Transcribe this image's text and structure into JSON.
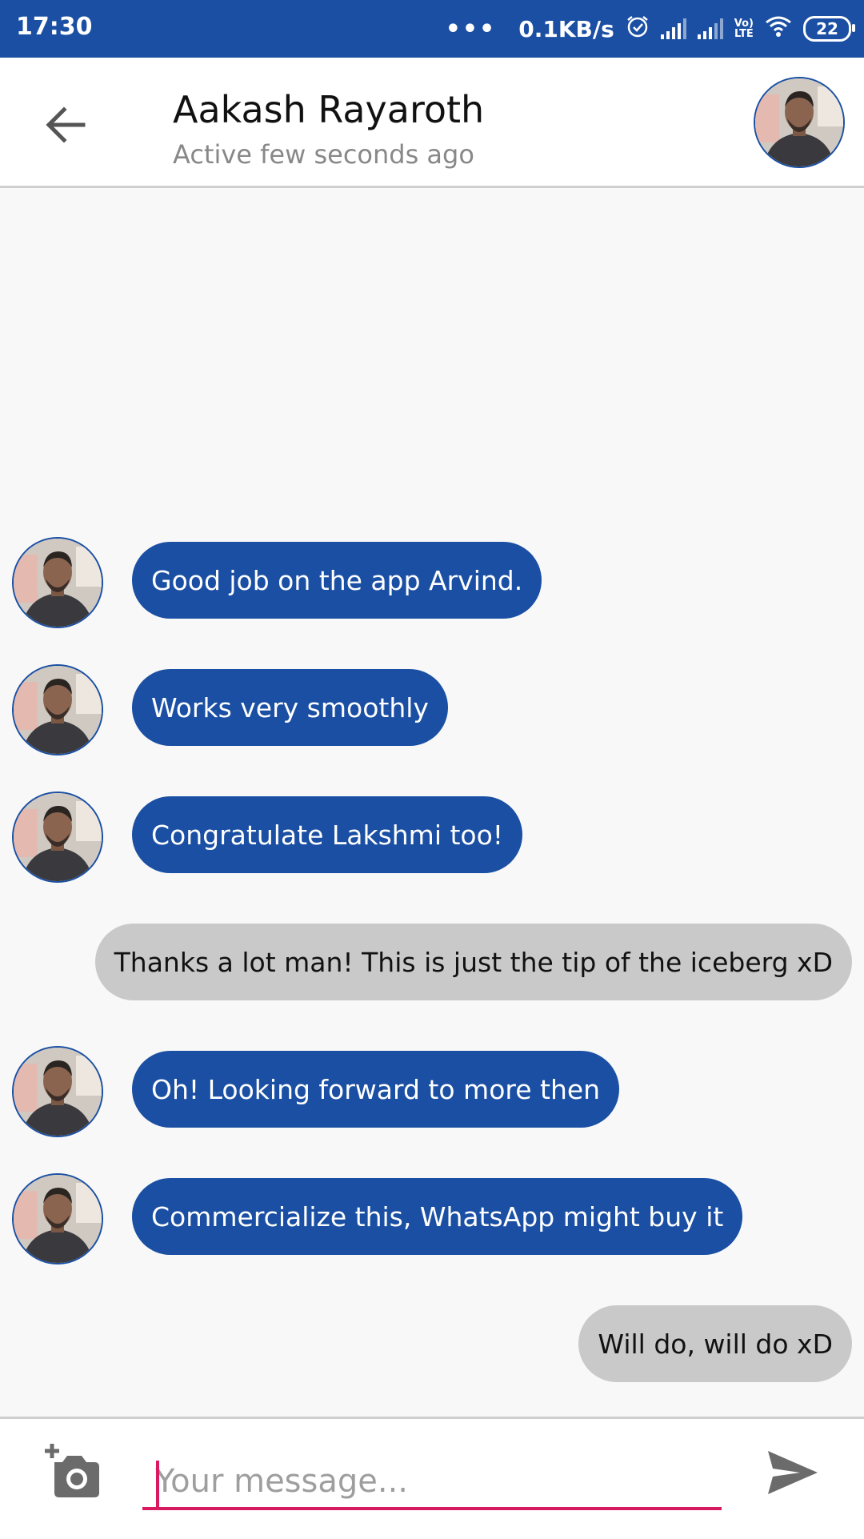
{
  "status_bar": {
    "time": "17:30",
    "more": "•••",
    "speed": "0.1KB/s",
    "battery": "22",
    "lte_top": "Vo)",
    "lte_bottom": "LTE",
    "icons": [
      "alarm-icon",
      "signal-icon",
      "signal-icon",
      "volte-icon",
      "wifi-icon",
      "battery-icon"
    ]
  },
  "header": {
    "name": "Aakash Rayaroth",
    "status": "Active few seconds ago",
    "back_icon": "arrow-left-icon"
  },
  "messages": [
    {
      "direction": "incoming",
      "text": "Good job on the app Arvind."
    },
    {
      "direction": "incoming",
      "text": "Works very smoothly"
    },
    {
      "direction": "incoming",
      "text": "Congratulate Lakshmi too!"
    },
    {
      "direction": "outgoing",
      "text": "Thanks a lot man! This is just the tip of the iceberg xD"
    },
    {
      "direction": "incoming",
      "text": "Oh! Looking forward to more then"
    },
    {
      "direction": "incoming",
      "text": "Commercialize this, WhatsApp might buy it"
    },
    {
      "direction": "outgoing",
      "text": "Will do, will do xD"
    }
  ],
  "composer": {
    "placeholder": "Your message...",
    "value": "",
    "camera_icon": "add-photo-icon",
    "send_icon": "send-icon"
  },
  "colors": {
    "primary": "#1a4fa3",
    "outgoing_bubble": "#c9c9c9",
    "accent": "#d81b60",
    "background": "#f8f8f8"
  }
}
